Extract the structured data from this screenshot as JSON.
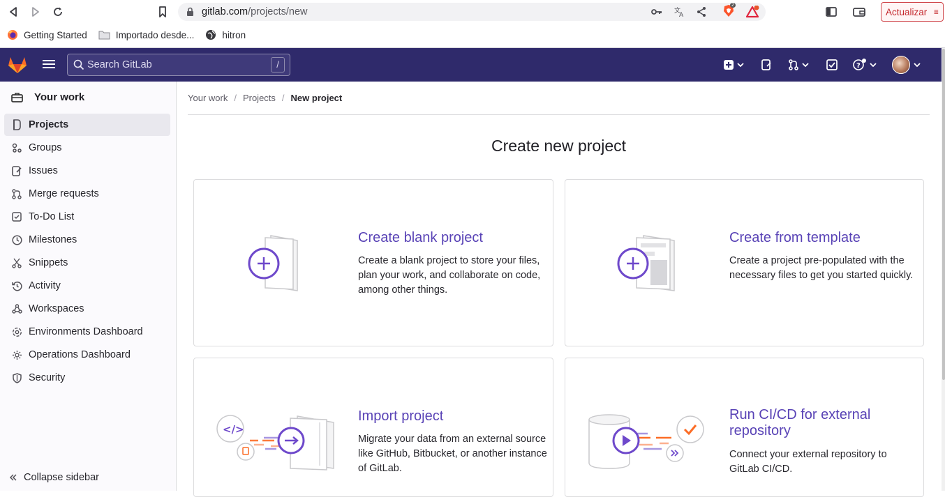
{
  "browser": {
    "url_host": "gitlab.com",
    "url_path": "/projects/new",
    "update_label": "Actualizar",
    "brave_badge_count": "2",
    "bookmarks": [
      {
        "label": "Getting Started"
      },
      {
        "label": "Importado desde..."
      },
      {
        "label": "hitron"
      }
    ]
  },
  "topbar": {
    "search_placeholder": "Search GitLab",
    "search_shortcut": "/"
  },
  "sidebar": {
    "header": "Your work",
    "items": [
      {
        "label": "Projects",
        "icon": "project-icon",
        "active": true
      },
      {
        "label": "Groups",
        "icon": "group-icon"
      },
      {
        "label": "Issues",
        "icon": "issues-icon"
      },
      {
        "label": "Merge requests",
        "icon": "merge-request-icon"
      },
      {
        "label": "To-Do List",
        "icon": "todo-icon"
      },
      {
        "label": "Milestones",
        "icon": "clock-icon"
      },
      {
        "label": "Snippets",
        "icon": "scissors-icon"
      },
      {
        "label": "Activity",
        "icon": "history-icon"
      },
      {
        "label": "Workspaces",
        "icon": "workspace-icon"
      },
      {
        "label": "Environments Dashboard",
        "icon": "environment-icon"
      },
      {
        "label": "Operations Dashboard",
        "icon": "cloud-gear-icon"
      },
      {
        "label": "Security",
        "icon": "shield-icon"
      }
    ],
    "collapse_label": "Collapse sidebar"
  },
  "breadcrumb": {
    "items": [
      "Your work",
      "Projects",
      "New project"
    ]
  },
  "main": {
    "title": "Create new project",
    "cards": [
      {
        "title": "Create blank project",
        "description": "Create a blank project to store your files, plan your work, and collaborate on code, among other things."
      },
      {
        "title": "Create from template",
        "description": "Create a project pre-populated with the necessary files to get you started quickly."
      },
      {
        "title": "Import project",
        "description": "Migrate your data from an external source like GitHub, Bitbucket, or another instance of GitLab."
      },
      {
        "title": "Run CI/CD for external repository",
        "description": "Connect your external repository to GitLab CI/CD."
      }
    ]
  },
  "colors": {
    "topbar": "#2f2a6b",
    "accent": "#5943b6",
    "orange": "#fc6d26"
  }
}
